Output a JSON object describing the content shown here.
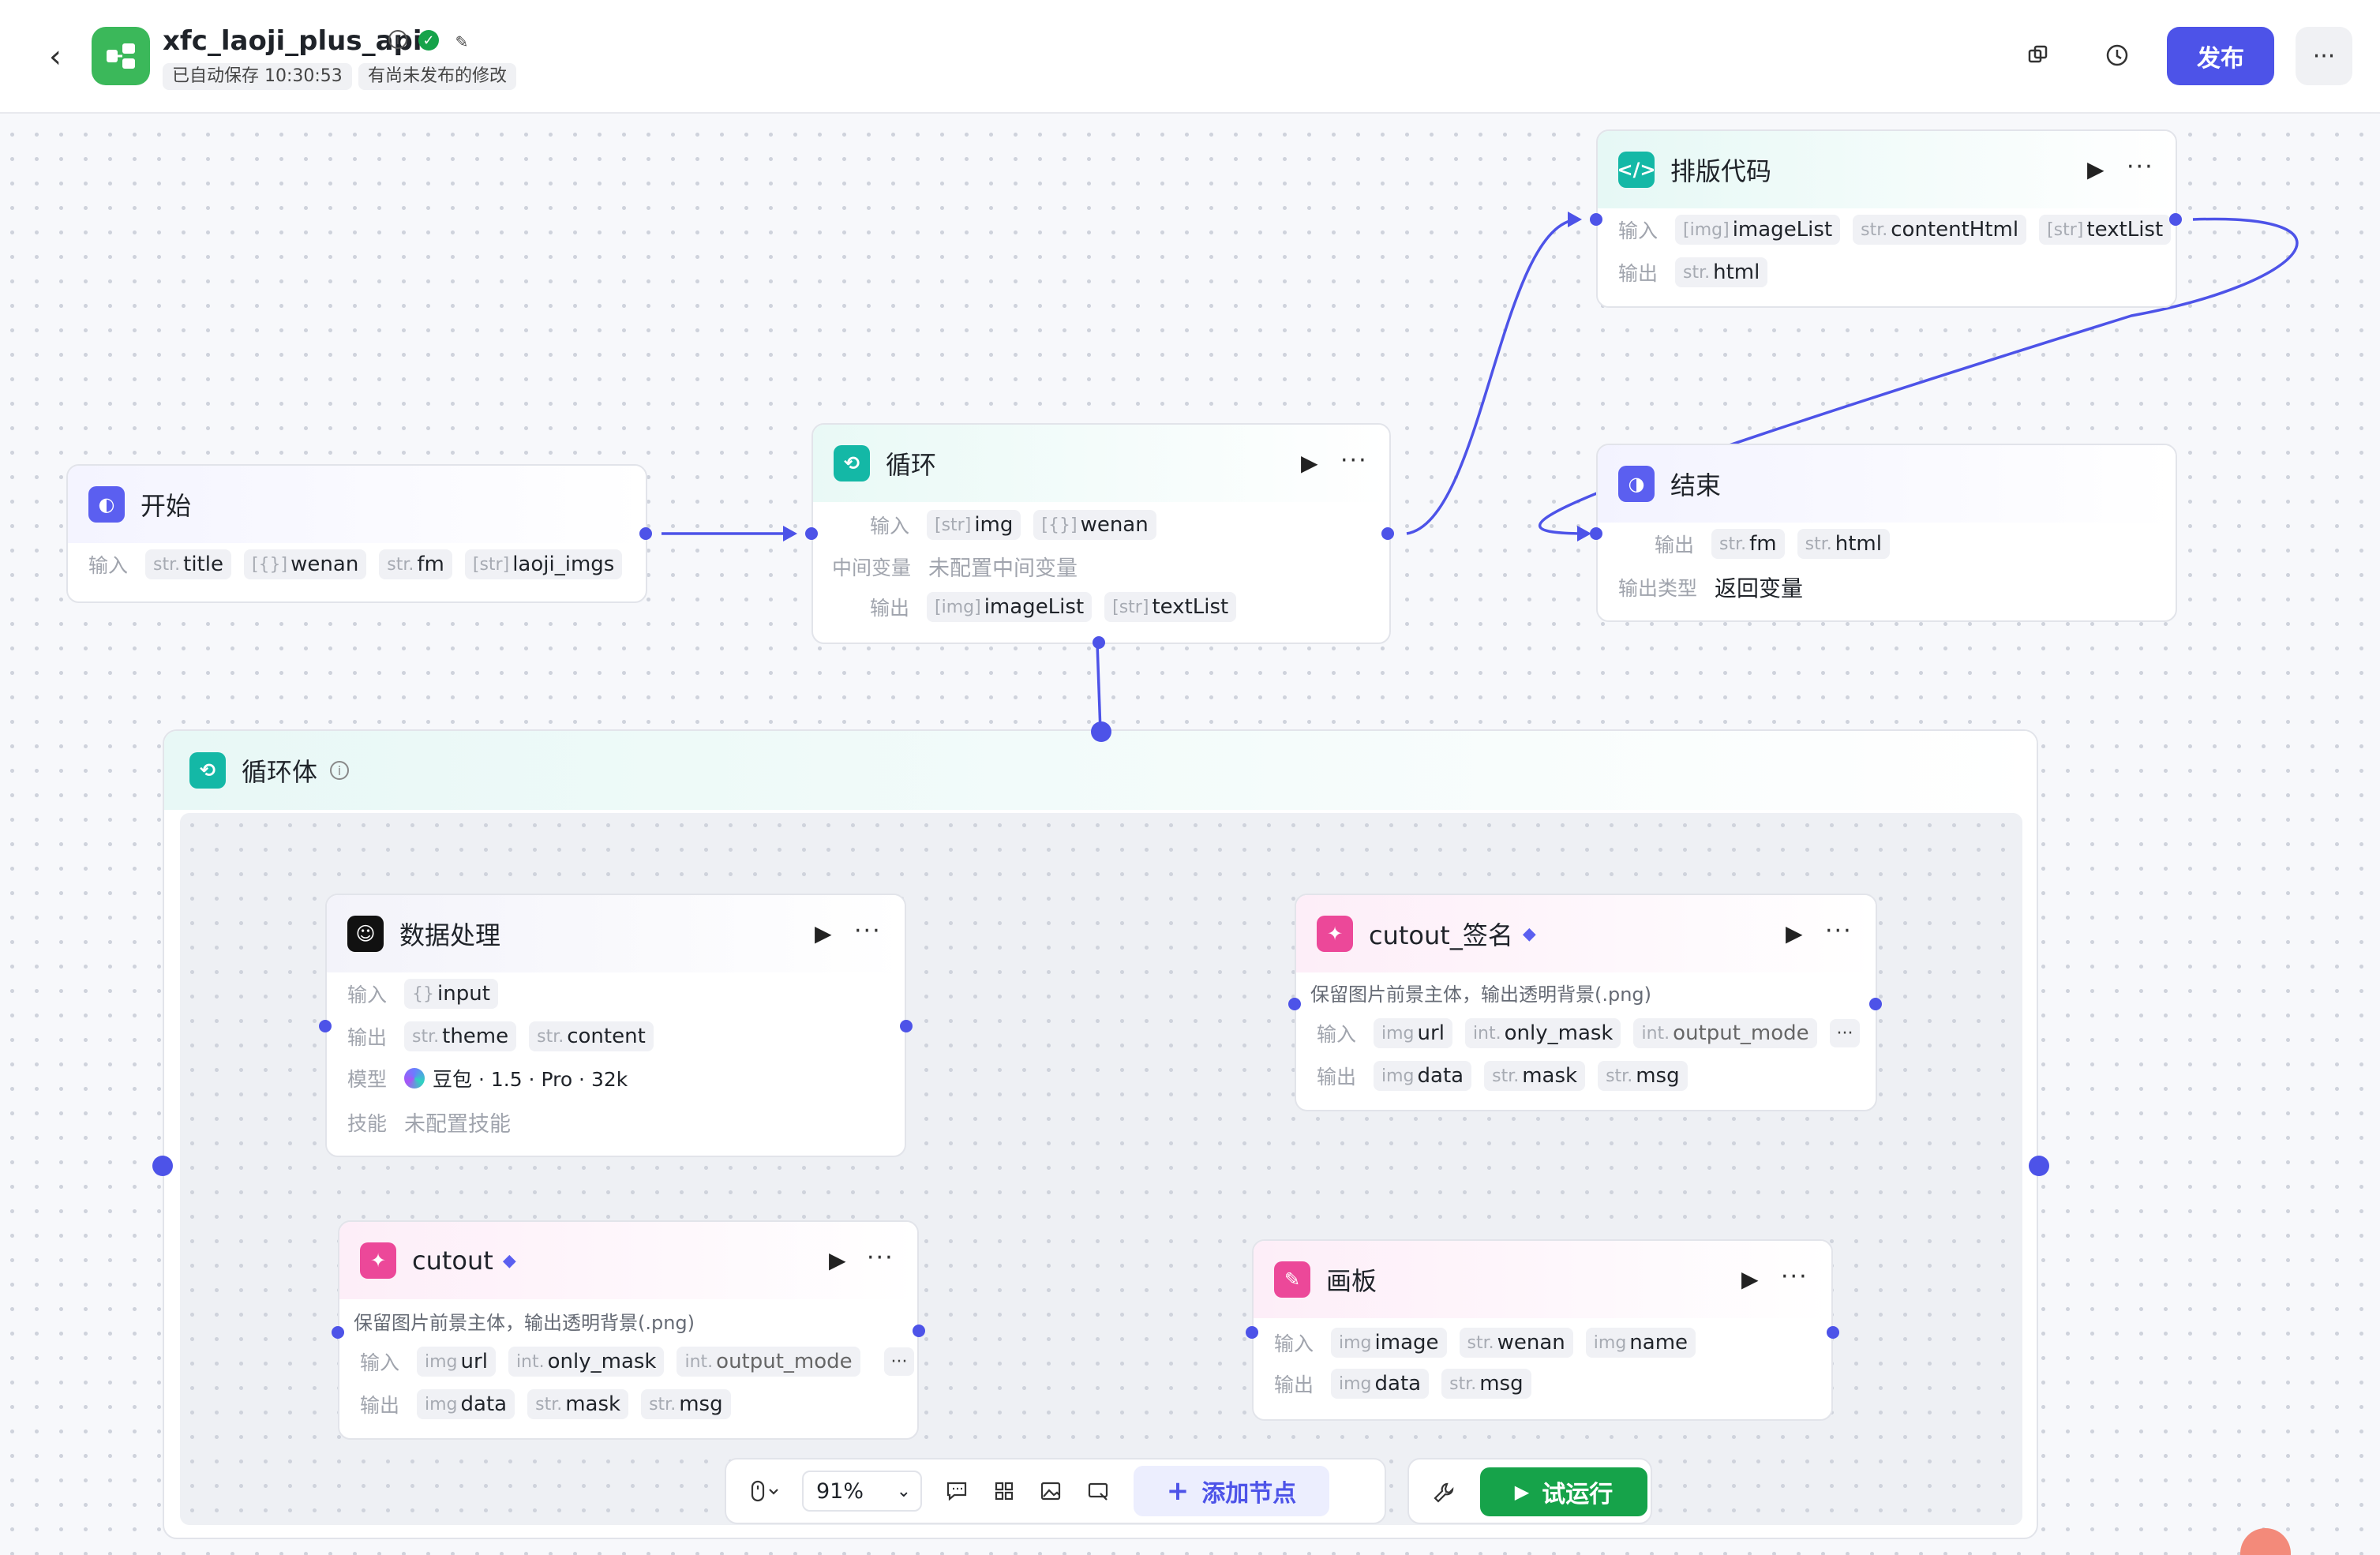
{
  "app": {
    "name": "xfc_laoji_plus_api",
    "autosave": "已自动保存 10:30:53",
    "unpublished": "有尚未发布的修改",
    "publish_label": "发布",
    "accent": "#4d53e8",
    "logo_color": "#3bb85a"
  },
  "labels": {
    "input": "输入",
    "output": "输出",
    "midvar": "中间变量",
    "model": "模型",
    "skill": "技能",
    "output_type": "输出类型"
  },
  "nodes": {
    "start": {
      "title": "开始",
      "inputs": [
        {
          "type": "str.",
          "name": "title"
        },
        {
          "type": "[{}]",
          "name": "wenan"
        },
        {
          "type": "str.",
          "name": "fm"
        },
        {
          "type": "[str]",
          "name": "laoji_imgs"
        }
      ]
    },
    "loop": {
      "title": "循环",
      "inputs": [
        {
          "type": "[str]",
          "name": "img"
        },
        {
          "type": "[{}]",
          "name": "wenan"
        }
      ],
      "midvar": "未配置中间变量",
      "outputs": [
        {
          "type": "[img]",
          "name": "imageList"
        },
        {
          "type": "[str]",
          "name": "textList"
        }
      ]
    },
    "code": {
      "title": "排版代码",
      "inputs": [
        {
          "type": "[img]",
          "name": "imageList"
        },
        {
          "type": "str.",
          "name": "contentHtml"
        },
        {
          "type": "[str]",
          "name": "textList"
        }
      ],
      "outputs": [
        {
          "type": "str.",
          "name": "html"
        }
      ]
    },
    "end": {
      "title": "结束",
      "outputs": [
        {
          "type": "str.",
          "name": "fm"
        },
        {
          "type": "str.",
          "name": "html"
        }
      ],
      "output_type": "返回变量"
    },
    "loopbody": {
      "title": "循环体"
    },
    "data": {
      "title": "数据处理",
      "inputs": [
        {
          "type": "{}",
          "name": "input"
        }
      ],
      "outputs": [
        {
          "type": "str.",
          "name": "theme"
        },
        {
          "type": "str.",
          "name": "content"
        }
      ],
      "model": "豆包 · 1.5 · Pro · 32k",
      "skill": "未配置技能"
    },
    "cutout_sign": {
      "title": "cutout_签名",
      "desc": "保留图片前景主体，输出透明背景(.png)",
      "inputs": [
        {
          "type": "img",
          "name": "url"
        },
        {
          "type": "int.",
          "name": "only_mask"
        },
        {
          "type": "int.",
          "name": "output_mode"
        }
      ],
      "outputs": [
        {
          "type": "img",
          "name": "data"
        },
        {
          "type": "str.",
          "name": "mask"
        },
        {
          "type": "str.",
          "name": "msg"
        }
      ]
    },
    "cutout": {
      "title": "cutout",
      "desc": "保留图片前景主体，输出透明背景(.png)",
      "inputs": [
        {
          "type": "img",
          "name": "url"
        },
        {
          "type": "int.",
          "name": "only_mask"
        },
        {
          "type": "int.",
          "name": "output_mode"
        }
      ],
      "outputs": [
        {
          "type": "img",
          "name": "data"
        },
        {
          "type": "str.",
          "name": "mask"
        },
        {
          "type": "str.",
          "name": "msg"
        }
      ]
    },
    "board": {
      "title": "画板",
      "inputs": [
        {
          "type": "img",
          "name": "image"
        },
        {
          "type": "str.",
          "name": "wenan"
        },
        {
          "type": "img",
          "name": "name"
        }
      ],
      "outputs": [
        {
          "type": "img",
          "name": "data"
        },
        {
          "type": "str.",
          "name": "msg"
        }
      ]
    }
  },
  "toolbar": {
    "zoom": "91%",
    "add_node": "添加节点",
    "run": "试运行"
  }
}
